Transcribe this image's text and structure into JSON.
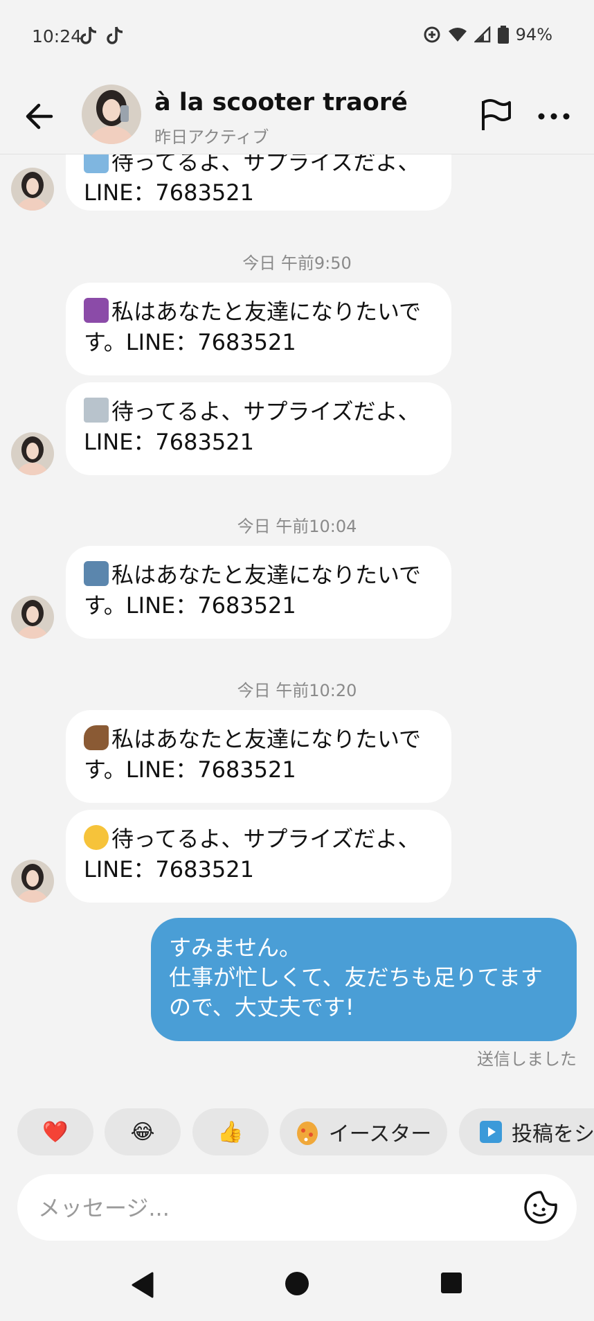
{
  "status_bar": {
    "time": "10:24",
    "battery": "94%"
  },
  "header": {
    "name": "à la scooter traoré",
    "subtitle": "昨日アクティブ"
  },
  "messages": [
    {
      "line1": "待ってるよ、サプライズだよ、",
      "line2": "LINE：7683521"
    },
    {
      "line1": "私はあなたと友達になりたいで",
      "line2": "す。LINE：7683521"
    },
    {
      "line1": "待ってるよ、サプライズだよ、",
      "line2": "LINE：7683521"
    },
    {
      "line1": "私はあなたと友達になりたいで",
      "line2": "す。LINE：7683521"
    },
    {
      "line1": "私はあなたと友達になりたいで",
      "line2": "す。LINE：7683521"
    },
    {
      "line1": "待ってるよ、サプライズだよ、",
      "line2": "LINE：7683521"
    }
  ],
  "timestamps": [
    "今日 午前9:50",
    "今日 午前10:04",
    "今日 午前10:20"
  ],
  "sent": {
    "line1": "すみません。",
    "line2": "仕事が忙しくて、友だちも足りてます",
    "line3": "ので、大丈夫です!",
    "status": "送信しました"
  },
  "reactions": [
    "❤️",
    "😂",
    "👍",
    "イースター",
    "投稿をシ"
  ],
  "input": {
    "placeholder": "メッセージ..."
  },
  "colors": {
    "sent_bubble": "#4a9ed6",
    "background": "#f3f3f3"
  }
}
